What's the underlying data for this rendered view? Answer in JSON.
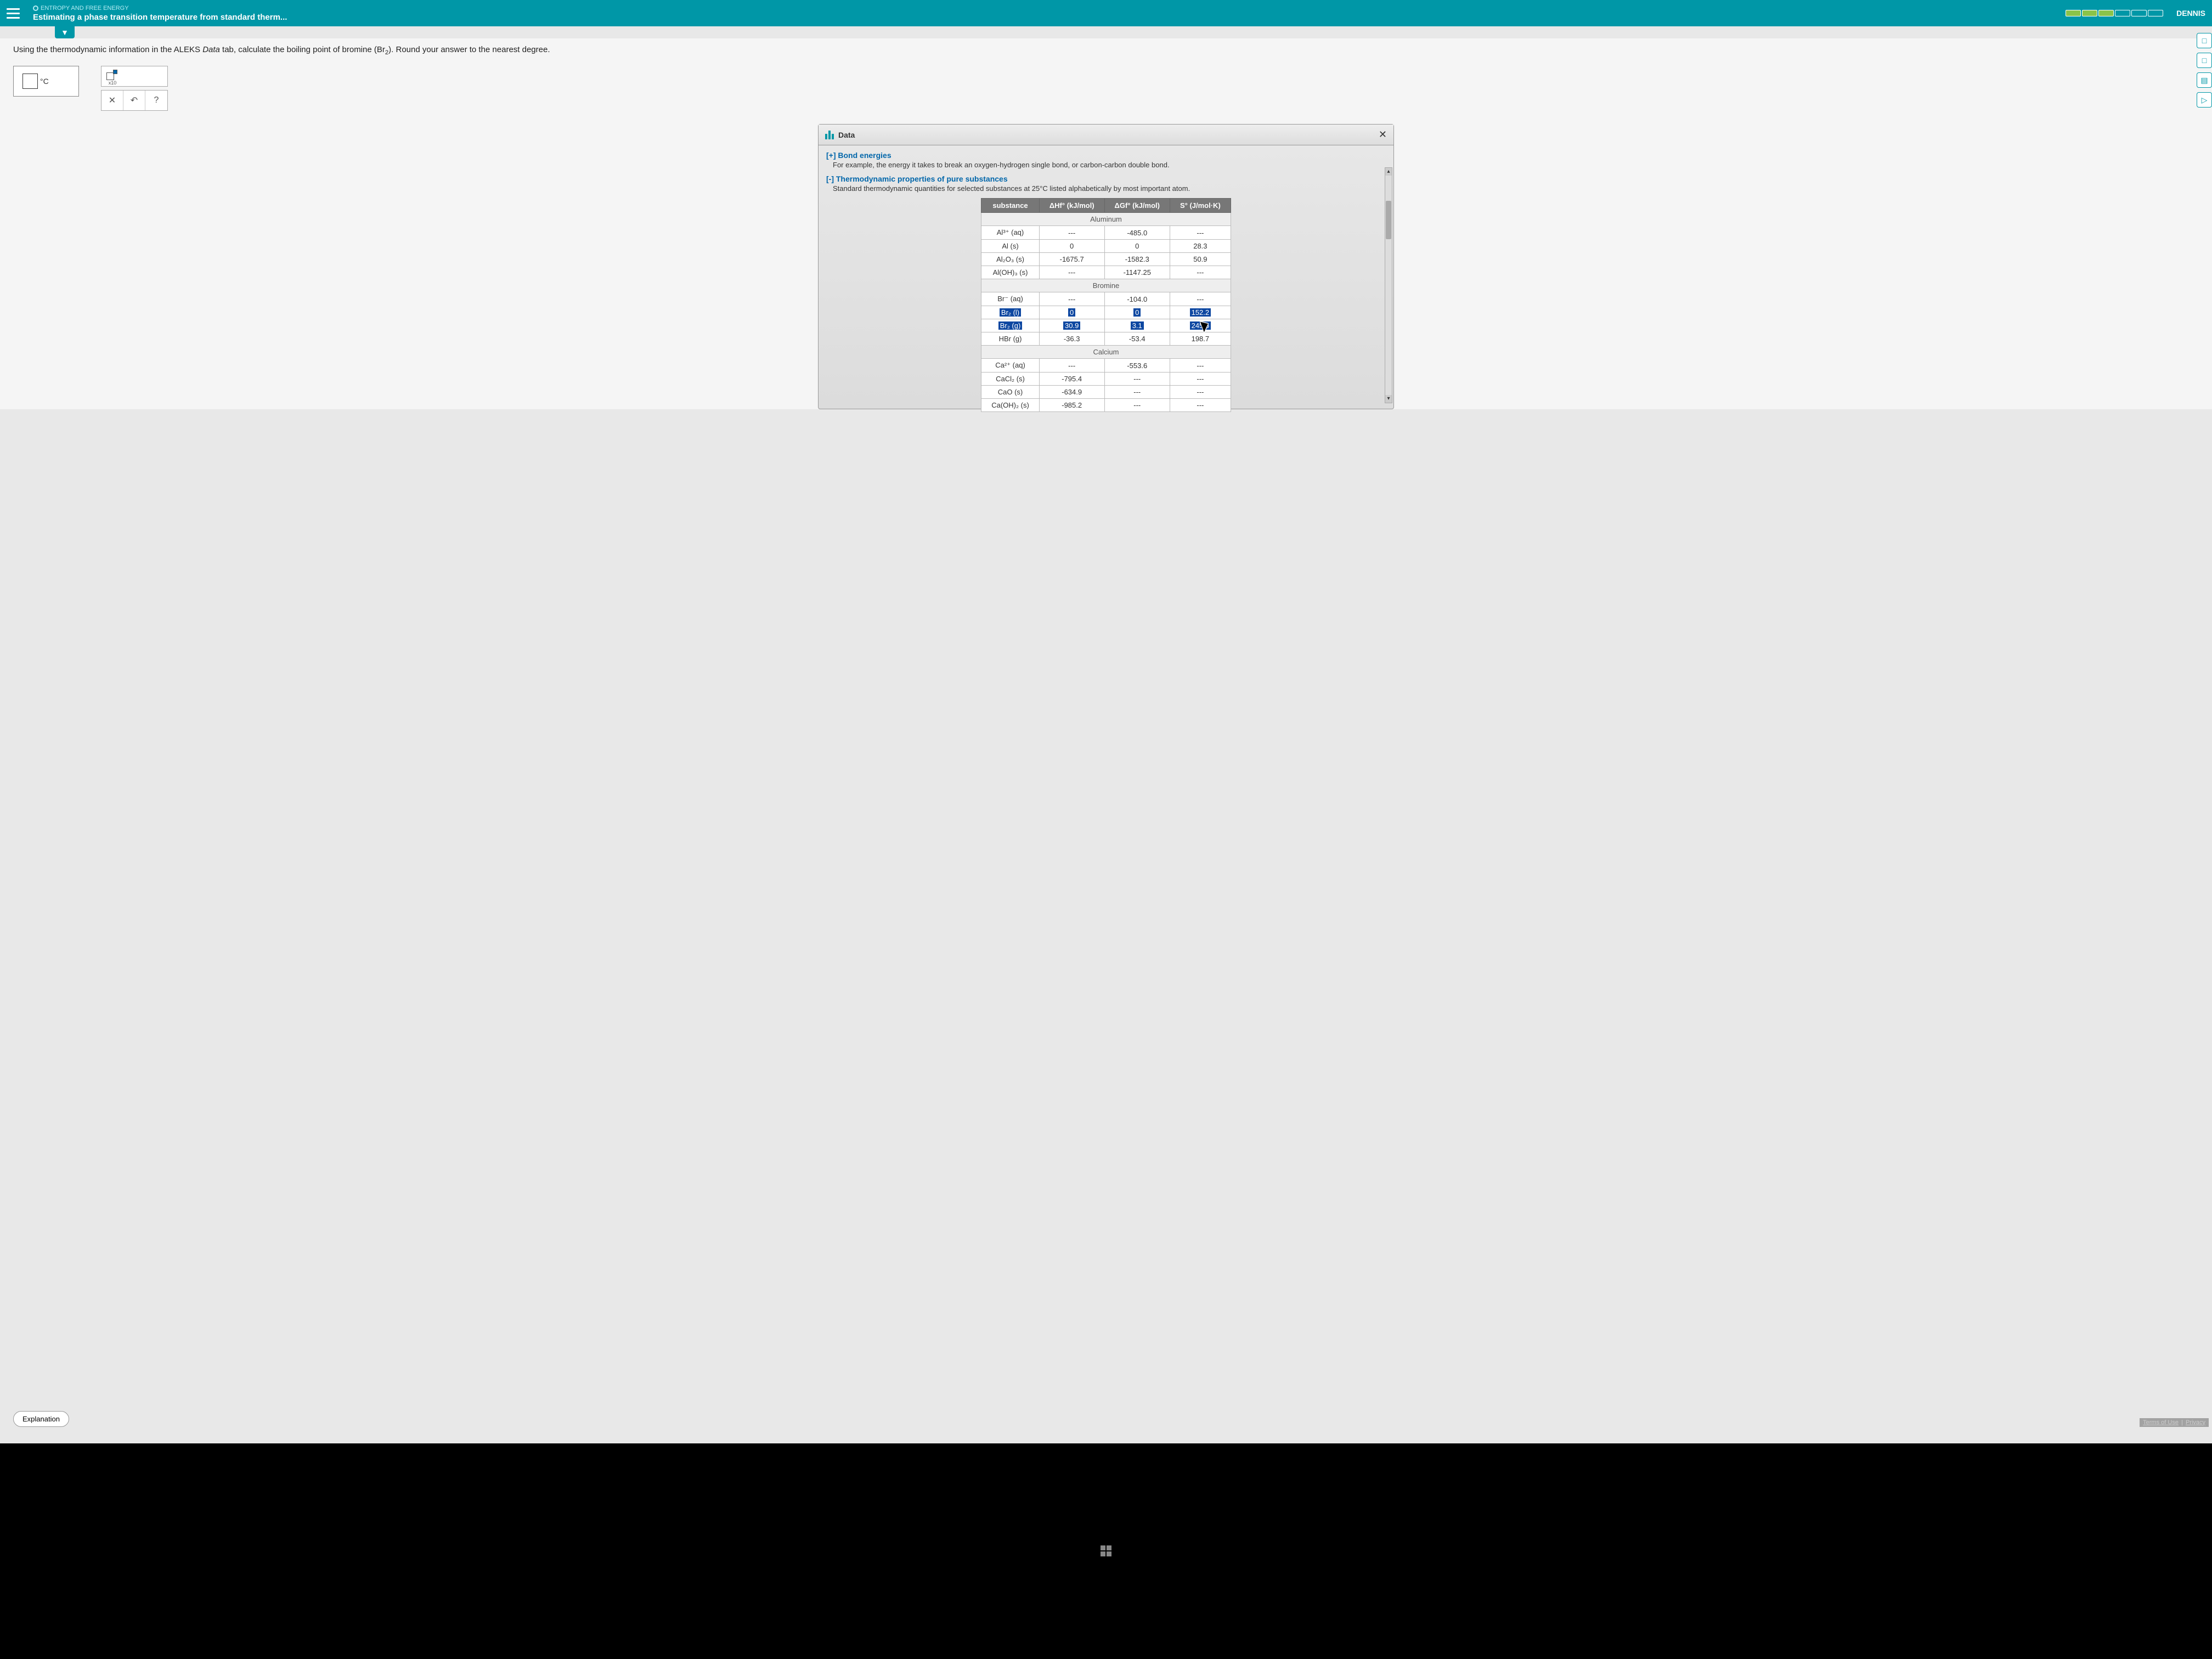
{
  "header": {
    "topic": "ENTROPY AND FREE ENERGY",
    "lesson": "Estimating a phase transition temperature from standard therm...",
    "user": "DENNIS"
  },
  "question": {
    "prefix": "Using the thermodynamic information in the ALEKS ",
    "data_word": "Data",
    "middle": " tab, calculate the boiling point of bromine ",
    "formula_base": "Br",
    "formula_sub": "2",
    "suffix": ". Round your answer to the nearest degree.",
    "unit": "°C"
  },
  "palette": {
    "x10": "x10",
    "clear": "✕",
    "undo": "↶",
    "help": "?"
  },
  "data_panel": {
    "title": "Data",
    "bond_toggle": "[+] Bond energies",
    "bond_desc": "For example, the energy it takes to break an oxygen-hydrogen single bond, or carbon-carbon double bond.",
    "thermo_toggle": "[-] Thermodynamic properties of pure substances",
    "thermo_desc": "Standard thermodynamic quantities for selected substances at 25°C listed alphabetically by most important atom.",
    "headers": {
      "substance": "substance",
      "dhf": "ΔHf° (kJ/mol)",
      "dgf": "ΔGf° (kJ/mol)",
      "s": "S° (J/mol·K)"
    },
    "categories": {
      "aluminum": "Aluminum",
      "bromine": "Bromine",
      "calcium": "Calcium"
    },
    "rows": {
      "al3": {
        "sub": "Al³⁺ (aq)",
        "h": "---",
        "g": "-485.0",
        "s": "---"
      },
      "al": {
        "sub": "Al (s)",
        "h": "0",
        "g": "0",
        "s": "28.3"
      },
      "al2o3": {
        "sub": "Al₂O₃ (s)",
        "h": "-1675.7",
        "g": "-1582.3",
        "s": "50.9"
      },
      "aloh3": {
        "sub": "Al(OH)₃ (s)",
        "h": "---",
        "g": "-1147.25",
        "s": "---"
      },
      "brminus": {
        "sub": "Br⁻ (aq)",
        "h": "---",
        "g": "-104.0",
        "s": "---"
      },
      "br2l": {
        "sub": "Br₂ (l)",
        "h": "0",
        "g": "0",
        "s": "152.2"
      },
      "br2g": {
        "sub": "Br₂ (g)",
        "h": "30.9",
        "g": "3.1",
        "s": "245.5"
      },
      "hbr": {
        "sub": "HBr (g)",
        "h": "-36.3",
        "g": "-53.4",
        "s": "198.7"
      },
      "ca2": {
        "sub": "Ca²⁺ (aq)",
        "h": "---",
        "g": "-553.6",
        "s": "---"
      },
      "cacl2": {
        "sub": "CaCl₂ (s)",
        "h": "-795.4",
        "g": "---",
        "s": "---"
      },
      "cao": {
        "sub": "CaO (s)",
        "h": "-634.9",
        "g": "---",
        "s": "---"
      },
      "caoh2": {
        "sub": "Ca(OH)₂ (s)",
        "h": "-985.2",
        "g": "---",
        "s": "---"
      }
    }
  },
  "buttons": {
    "explanation": "Explanation"
  },
  "footer": {
    "terms": "Terms of Use",
    "privacy": "Privacy"
  }
}
